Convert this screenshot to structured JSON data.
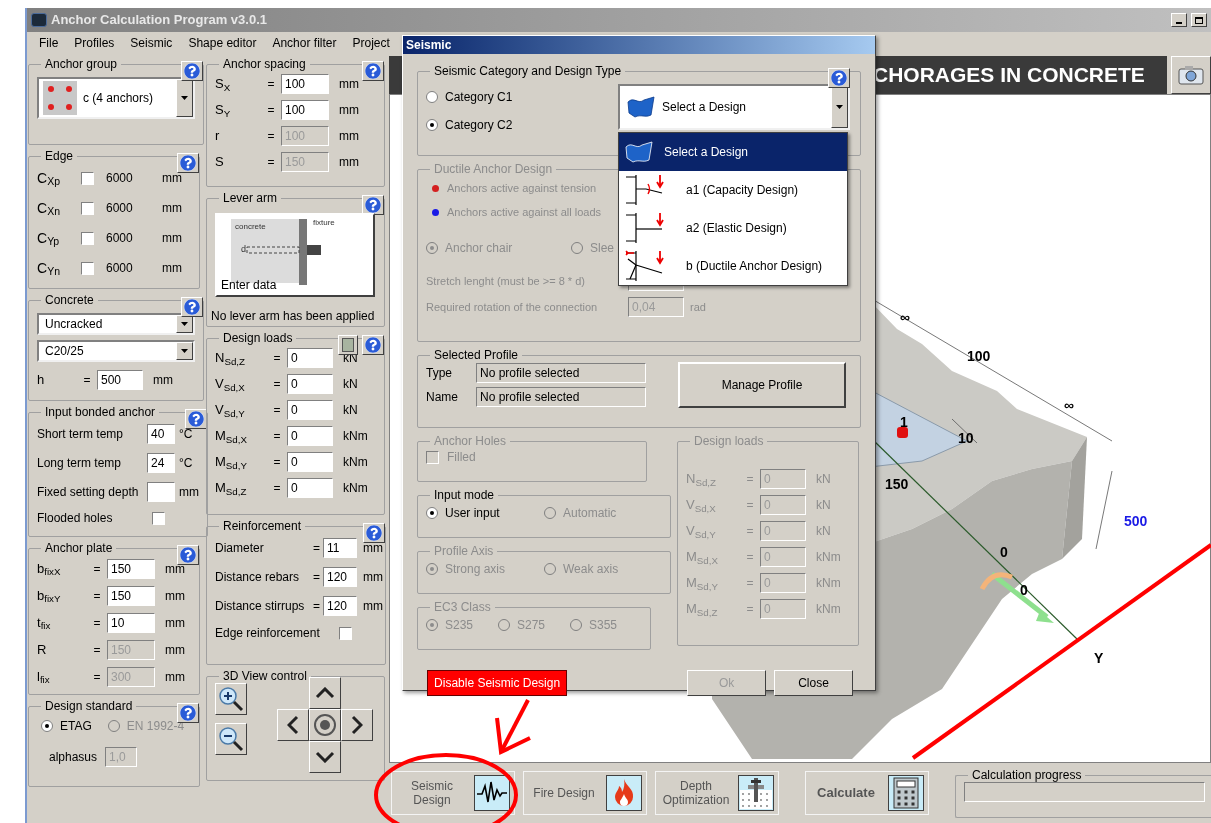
{
  "window": {
    "title": "Anchor Calculation Program v3.0.1"
  },
  "menu": [
    "File",
    "Profiles",
    "Seismic",
    "Shape editor",
    "Anchor filter",
    "Project"
  ],
  "anchor_group": {
    "title": "Anchor group",
    "value": "c (4 anchors)"
  },
  "edge": {
    "title": "Edge",
    "rows": [
      {
        "label": "C$_{Xp}$",
        "checked": false,
        "value": "6000",
        "unit": "mm"
      },
      {
        "label": "C$_{Xn}$",
        "checked": false,
        "value": "6000",
        "unit": "mm"
      },
      {
        "label": "C$_{Yp}$",
        "checked": false,
        "value": "6000",
        "unit": "mm"
      },
      {
        "label": "C$_{Yn}$",
        "checked": false,
        "value": "6000",
        "unit": "mm"
      }
    ]
  },
  "concrete": {
    "title": "Concrete",
    "state": "Uncracked",
    "grade": "C20/25",
    "h": {
      "label": "h",
      "sign": "=",
      "value": "500",
      "unit": "mm",
      "disabled": false
    }
  },
  "bonded": {
    "title": "Input bonded anchor",
    "rows": [
      {
        "kind": "field",
        "label": "Short term temp",
        "value": "40",
        "unit": "°C"
      },
      {
        "kind": "field",
        "label": "Long term temp",
        "value": "24",
        "unit": "°C"
      },
      {
        "kind": "field",
        "label": "Fixed setting depth",
        "unit": "mm"
      },
      {
        "kind": "check",
        "label": "Flooded holes",
        "checked": false
      }
    ]
  },
  "anchor_plate": {
    "title": "Anchor plate",
    "rows": [
      {
        "label": "b$_{fixX}$",
        "sign": "=",
        "value": "150",
        "unit": "mm",
        "disabled": false
      },
      {
        "label": "b$_{fixY}$",
        "sign": "=",
        "value": "150",
        "unit": "mm",
        "disabled": false
      },
      {
        "label": "t$_{fix}$",
        "sign": "=",
        "value": "10",
        "unit": "mm",
        "disabled": false
      },
      {
        "label": "R",
        "sign": "=",
        "value": "150",
        "unit": "mm",
        "disabled": true
      },
      {
        "label": "l$_{fix}$",
        "sign": "=",
        "value": "300",
        "unit": "mm",
        "disabled": true
      }
    ]
  },
  "design_standard": {
    "title": "Design standard",
    "options": [
      {
        "label": "ETAG",
        "selected": true,
        "disabled": false
      },
      {
        "label": "EN 1992-4",
        "selected": false,
        "disabled": true
      }
    ],
    "alphasus": {
      "label": "alphasus",
      "value": "1,0",
      "disabled": true
    }
  },
  "anchor_spacing": {
    "title": "Anchor spacing",
    "rows": [
      {
        "label": "S$_{X}$",
        "sign": "=",
        "value": "100",
        "unit": "mm",
        "disabled": false
      },
      {
        "label": "S$_{Y}$",
        "sign": "=",
        "value": "100",
        "unit": "mm",
        "disabled": false
      },
      {
        "label": "r",
        "sign": "=",
        "value": "100",
        "unit": "mm",
        "disabled": true
      },
      {
        "label": "S",
        "sign": "=",
        "value": "150",
        "unit": "mm",
        "disabled": true
      }
    ]
  },
  "lever_arm": {
    "title": "Lever arm",
    "diagram_labels": [
      "concrete",
      "fixture",
      "d"
    ],
    "button": "Enter data",
    "status": "No lever arm has been applied"
  },
  "design_loads": {
    "title": "Design loads",
    "rows": [
      {
        "label": "N$_{Sd,Z}$",
        "sign": "=",
        "value": "0",
        "unit": "kN",
        "disabled": false
      },
      {
        "label": "V$_{Sd,X}$",
        "sign": "=",
        "value": "0",
        "unit": "kN",
        "disabled": false
      },
      {
        "label": "V$_{Sd,Y}$",
        "sign": "=",
        "value": "0",
        "unit": "kN",
        "disabled": false
      },
      {
        "label": "M$_{Sd,X}$",
        "sign": "=",
        "value": "0",
        "unit": "kNm",
        "disabled": false
      },
      {
        "label": "M$_{Sd,Y}$",
        "sign": "=",
        "value": "0",
        "unit": "kNm",
        "disabled": false
      },
      {
        "label": "M$_{Sd,Z}$",
        "sign": "=",
        "value": "0",
        "unit": "kNm",
        "disabled": false
      }
    ]
  },
  "reinforcement": {
    "title": "Reinforcement",
    "rows": [
      {
        "kind": "field",
        "label": "Diameter",
        "sign": "=",
        "value": "11",
        "unit": "mm"
      },
      {
        "kind": "field",
        "label": "Distance rebars",
        "sign": "=",
        "value": "120",
        "unit": "mm"
      },
      {
        "kind": "field",
        "label": "Distance stirrups",
        "sign": "=",
        "value": "120",
        "unit": "mm"
      },
      {
        "kind": "check",
        "label": "Edge reinforcement",
        "checked": false
      }
    ]
  },
  "view_control": {
    "title": "3D View control"
  },
  "viewport": {
    "banner": "CHORAGES IN CONCRETE",
    "labels": [
      {
        "text": "∞",
        "kind": "dimension"
      },
      {
        "text": "100",
        "kind": "dimension"
      },
      {
        "text": "∞",
        "kind": "dimension"
      },
      {
        "text": "1",
        "kind": "dimension"
      },
      {
        "text": "10",
        "kind": "dimension"
      },
      {
        "text": "150",
        "kind": "dimension"
      },
      {
        "text": "500",
        "kind": "height"
      },
      {
        "text": "0",
        "kind": "dimension"
      },
      {
        "text": "0",
        "kind": "dimension"
      },
      {
        "text": "Y",
        "kind": "axis"
      }
    ]
  },
  "toolbar": [
    {
      "label": "Seismic Design",
      "kind": "seismic"
    },
    {
      "label": "Fire Design",
      "kind": "fire"
    },
    {
      "label": "Depth Optimization",
      "kind": "depth"
    },
    {
      "label": "Calculate",
      "kind": "calculate"
    }
  ],
  "progress": {
    "title": "Calculation progress",
    "level": 0
  },
  "dialog": {
    "title": "Seismic",
    "category": {
      "title": "Seismic Category and Design Type",
      "options": [
        {
          "label": "Category C1",
          "selected": false,
          "disabled": false
        },
        {
          "label": "Category C2",
          "selected": true,
          "disabled": false
        }
      ],
      "design": {
        "value": "Select a Design",
        "options": [
          {
            "label": "Select a Design",
            "kind": "default",
            "selected": true
          },
          {
            "label": "a1 (Capacity Design)",
            "kind": "a1",
            "selected": false
          },
          {
            "label": "a2 (Elastic Design)",
            "kind": "a2",
            "selected": false
          },
          {
            "label": "b (Ductile Anchor Design)",
            "kind": "b",
            "selected": false
          }
        ]
      }
    },
    "ductile": {
      "title": "Ductile Anchor Design",
      "disabled": true,
      "legend": [
        {
          "label": "Anchors active against tension",
          "color": "#d42020"
        },
        {
          "label": "Anchors active against all loads",
          "color": "#1a1ae6"
        }
      ],
      "types": [
        {
          "label": "Anchor chair",
          "selected": true,
          "disabled": true
        },
        {
          "label": "Slee",
          "selected": false,
          "disabled": true
        }
      ],
      "stretch": {
        "label": "Stretch lenght (must be >= 8 * d)"
      },
      "rotation": {
        "label": "Required rotation of the connection",
        "value": "0,04",
        "unit": "rad"
      }
    },
    "profile": {
      "title": "Selected Profile",
      "rows": [
        {
          "label": "Type",
          "value": "No profile selected"
        },
        {
          "label": "Name",
          "value": "No profile selected"
        }
      ],
      "button": "Manage Profile"
    },
    "holes": {
      "title": "Anchor Holes",
      "disabled": true,
      "filled": {
        "label": "Filled",
        "checked": false
      }
    },
    "input_mode": {
      "title": "Input mode",
      "disabled": false,
      "options": [
        {
          "label": "User input",
          "selected": true,
          "disabled": false
        },
        {
          "label": "Automatic",
          "selected": false,
          "disabled": true
        }
      ]
    },
    "axis": {
      "title": "Profile Axis",
      "disabled": true,
      "options": [
        {
          "label": "Strong axis",
          "selected": true,
          "disabled": true
        },
        {
          "label": "Weak axis",
          "selected": false,
          "disabled": true
        }
      ]
    },
    "ec3": {
      "title": "EC3 Class",
      "disabled": true,
      "options": [
        {
          "label": "S235",
          "selected": true,
          "disabled": true
        },
        {
          "label": "S275",
          "selected": false,
          "disabled": true
        },
        {
          "label": "S355",
          "selected": false,
          "disabled": true
        }
      ]
    },
    "loads": {
      "title": "Design loads",
      "disabled": true,
      "rows": [
        {
          "label": "N$_{Sd,Z}$",
          "sign": "=",
          "value": "0",
          "unit": "kN",
          "disabled": true
        },
        {
          "label": "V$_{Sd,X}$",
          "sign": "=",
          "value": "0",
          "unit": "kN",
          "disabled": true
        },
        {
          "label": "V$_{Sd,Y}$",
          "sign": "=",
          "value": "0",
          "unit": "kN",
          "disabled": true
        },
        {
          "label": "M$_{Sd,X}$",
          "sign": "=",
          "value": "0",
          "unit": "kNm",
          "disabled": true
        },
        {
          "label": "M$_{Sd,Y}$",
          "sign": "=",
          "value": "0",
          "unit": "kNm",
          "disabled": true
        },
        {
          "label": "M$_{Sd,Z}$",
          "sign": "=",
          "value": "0",
          "unit": "kNm",
          "disabled": true
        }
      ]
    },
    "buttons": [
      {
        "label": "Disable Seismic Design",
        "kind": "danger",
        "disabled": false
      },
      {
        "label": "Ok",
        "kind": "normal",
        "disabled": true
      },
      {
        "label": "Close",
        "kind": "normal",
        "disabled": false
      }
    ]
  }
}
